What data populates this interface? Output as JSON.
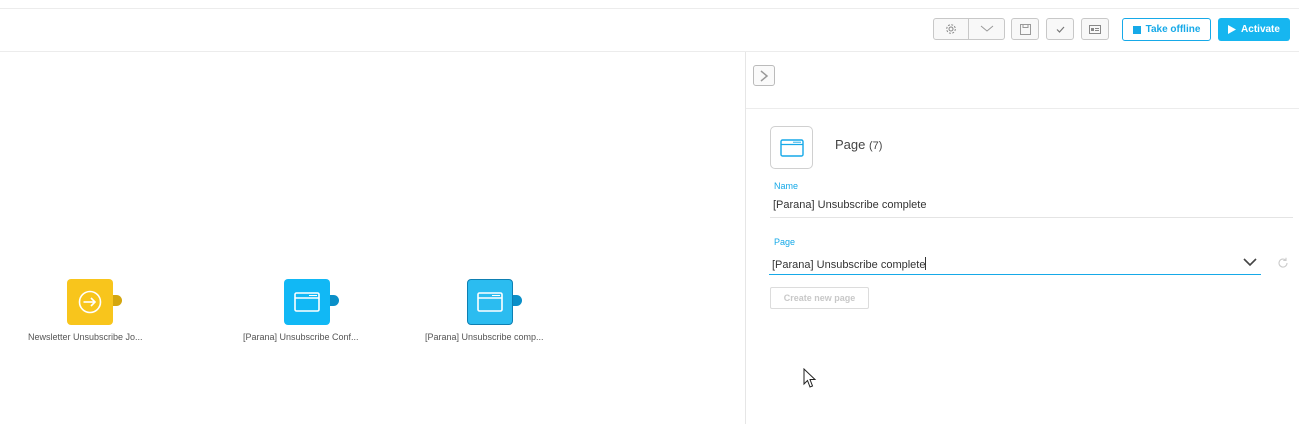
{
  "toolbar": {
    "settings_icon": "gear-icon",
    "dropdown_icon": "chevron-down-icon",
    "save_icon": "save-icon",
    "validate_icon": "check-icon",
    "preview_icon": "preview-icon",
    "take_offline_label": "Take offline",
    "activate_label": "Activate",
    "accent_color": "#16b6f0"
  },
  "canvas": {
    "nodes": [
      {
        "label": "Newsletter Unsubscribe Jo...",
        "type": "entry",
        "color": "#f8c51c",
        "icon": "entry-arrow-icon"
      },
      {
        "label": "[Parana] Unsubscribe Conf...",
        "type": "page",
        "color": "#11b8f5",
        "icon": "page-icon"
      },
      {
        "label": "[Parana] Unsubscribe comp...",
        "type": "page",
        "color": "#2bbcf0",
        "icon": "page-icon",
        "selected": true
      }
    ]
  },
  "panel": {
    "collapse_icon": "chevron-right-icon",
    "title": "Page",
    "count": "(7)",
    "name_label": "Name",
    "name_value": "[Parana] Unsubscribe complete",
    "page_label": "Page",
    "page_value": "[Parana] Unsubscribe complete",
    "create_button": "Create new page"
  }
}
